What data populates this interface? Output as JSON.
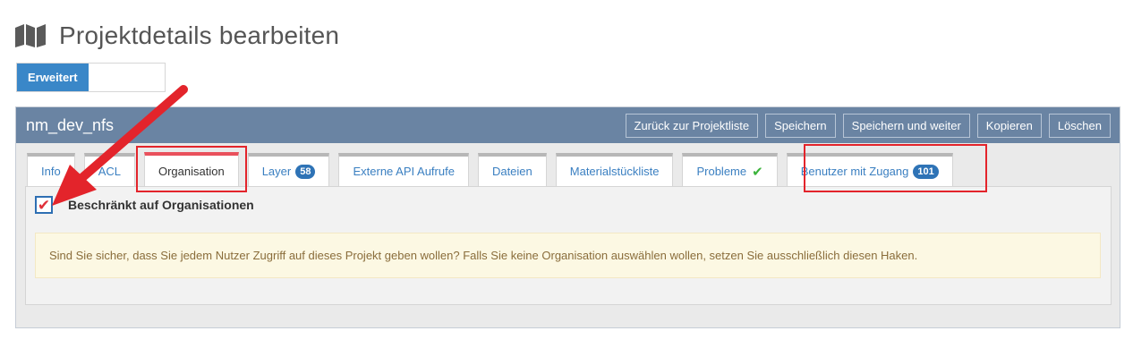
{
  "header": {
    "title": "Projektdetails bearbeiten",
    "icon": "map-icon"
  },
  "mode_switch": {
    "active_label": "Erweitert"
  },
  "panel": {
    "project_name": "nm_dev_nfs",
    "actions": [
      {
        "label": "Zurück zur Projektliste"
      },
      {
        "label": "Speichern"
      },
      {
        "label": "Speichern und weiter"
      },
      {
        "label": "Kopieren"
      },
      {
        "label": "Löschen"
      }
    ]
  },
  "tabs": [
    {
      "label": "Info"
    },
    {
      "label": "ACL"
    },
    {
      "label": "Organisation",
      "active": true
    },
    {
      "label": "Layer",
      "badge": "58"
    },
    {
      "label": "Externe API Aufrufe"
    },
    {
      "label": "Dateien"
    },
    {
      "label": "Materialstückliste"
    },
    {
      "label": "Probleme",
      "icon": "check-icon"
    },
    {
      "label": "Benutzer mit Zugang",
      "badge": "101"
    }
  ],
  "organisation": {
    "checkbox_label": "Beschränkt auf Organisationen",
    "checkbox_checked": true,
    "warning_text": "Sind Sie sicher, dass Sie jedem Nutzer Zugriff auf dieses Projekt geben wollen? Falls Sie keine Organisation auswählen wollen, setzen Sie ausschließlich diesen Haken."
  },
  "colors": {
    "accent": "#3a87c8",
    "panel_heading": "#6a84a3",
    "active_tab_top": "#e9505c",
    "highlight": "#e3242b",
    "success": "#3bb33b"
  }
}
